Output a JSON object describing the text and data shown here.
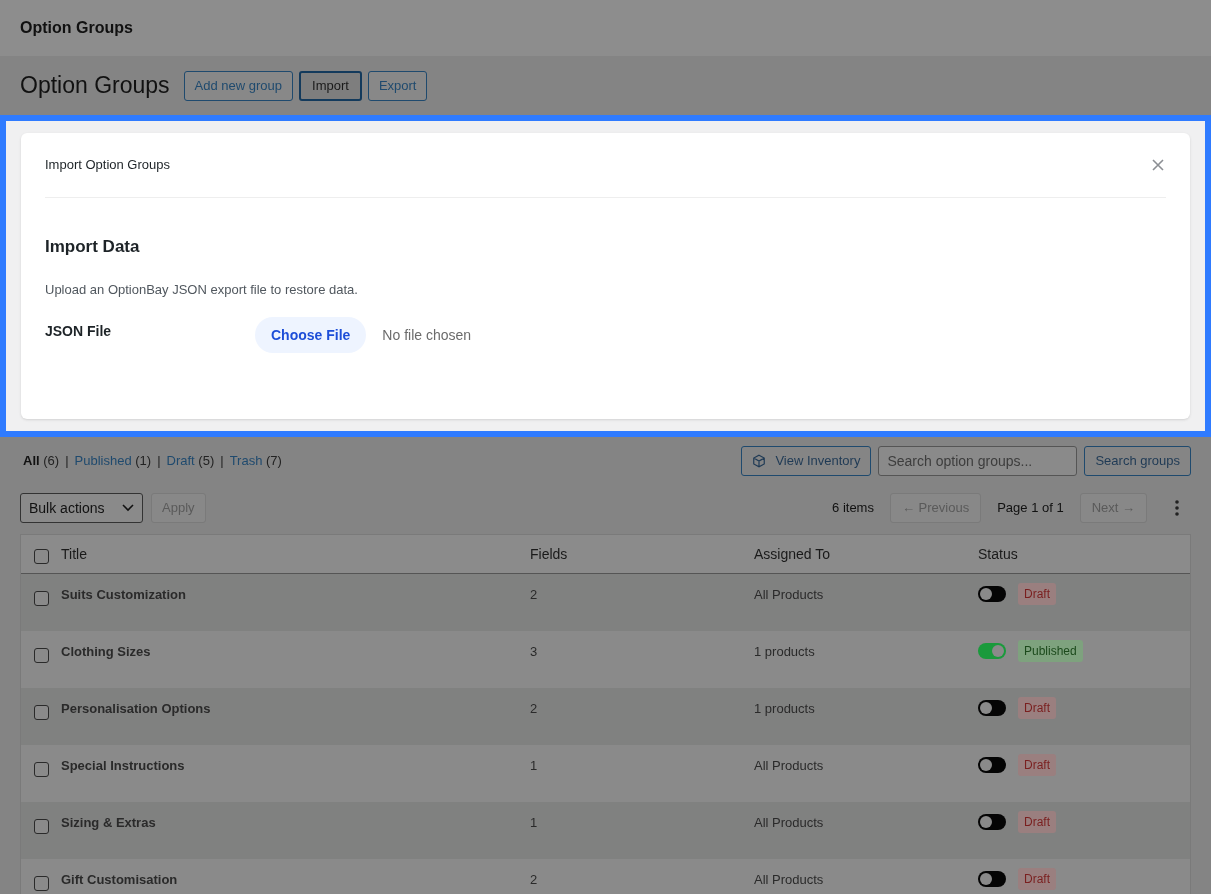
{
  "top_bar": {
    "title": "Option Groups"
  },
  "header": {
    "title": "Option Groups",
    "buttons": [
      {
        "label": "Add new group",
        "selected": false
      },
      {
        "label": "Import",
        "selected": true
      },
      {
        "label": "Export",
        "selected": false
      }
    ]
  },
  "import_panel": {
    "title": "Import Option Groups",
    "heading": "Import Data",
    "description": "Upload an OptionBay JSON export file to restore data.",
    "field_label": "JSON File",
    "file_button": "Choose File",
    "file_status": "No file chosen"
  },
  "filters": [
    {
      "label": "All",
      "count": "(6)",
      "selected": true
    },
    {
      "separator": "|",
      "label": "Published",
      "count": "(1)",
      "selected": false
    },
    {
      "separator": "|",
      "label": "Draft",
      "count": "(5)",
      "selected": false
    },
    {
      "separator": "|",
      "label": "Trash",
      "count": "(7)",
      "selected": false
    }
  ],
  "view_inventory": "View Inventory",
  "search": {
    "placeholder": "Search option groups...",
    "button": "Search groups"
  },
  "bulk": {
    "select": "Bulk actions",
    "apply": "Apply"
  },
  "pagination": {
    "count": "6 items",
    "previous": "← Previous",
    "page": "Page 1 of 1",
    "next": "Next →"
  },
  "table": {
    "select_all_checked": false,
    "columns": [
      "Title",
      "Fields",
      "Assigned To",
      "Status"
    ],
    "rows": [
      {
        "title": "Suits Customization",
        "fields": "2",
        "assigned": "All Products",
        "checked": false,
        "on": false,
        "status": "Draft"
      },
      {
        "title": "Clothing Sizes",
        "fields": "3",
        "assigned": "1 products",
        "checked": false,
        "on": true,
        "status": "Published"
      },
      {
        "title": "Personalisation Options",
        "fields": "2",
        "assigned": "1 products",
        "checked": false,
        "on": false,
        "status": "Draft"
      },
      {
        "title": "Special Instructions",
        "fields": "1",
        "assigned": "All Products",
        "checked": false,
        "on": false,
        "status": "Draft"
      },
      {
        "title": "Sizing & Extras",
        "fields": "1",
        "assigned": "All Products",
        "checked": false,
        "on": false,
        "status": "Draft"
      },
      {
        "title": "Gift Customisation",
        "fields": "2",
        "assigned": "All Products",
        "checked": false,
        "on": false,
        "status": "Draft"
      }
    ]
  }
}
